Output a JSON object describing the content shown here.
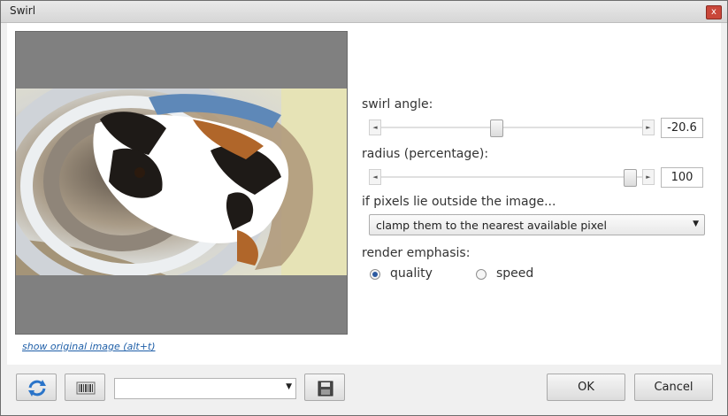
{
  "window": {
    "title": "Swirl",
    "close_glyph": "x"
  },
  "preview": {
    "show_original_link": "show original image (alt+t)"
  },
  "controls": {
    "swirl_angle": {
      "label": "swirl angle:",
      "value": "-20.6",
      "slider_fraction": 0.43
    },
    "radius": {
      "label": "radius (percentage):",
      "value": "100",
      "slider_fraction": 1.0
    },
    "edge": {
      "label": "if pixels lie outside the image...",
      "selected": "clamp them to the nearest available pixel"
    },
    "render": {
      "label": "render emphasis:",
      "options": [
        "quality",
        "speed"
      ],
      "selected": "quality"
    }
  },
  "footer": {
    "reset_icon": "refresh-icon",
    "randomize_icon": "barcode-icon",
    "preset_value": "",
    "save_icon": "save-preset-icon",
    "ok_label": "OK",
    "cancel_label": "Cancel"
  }
}
